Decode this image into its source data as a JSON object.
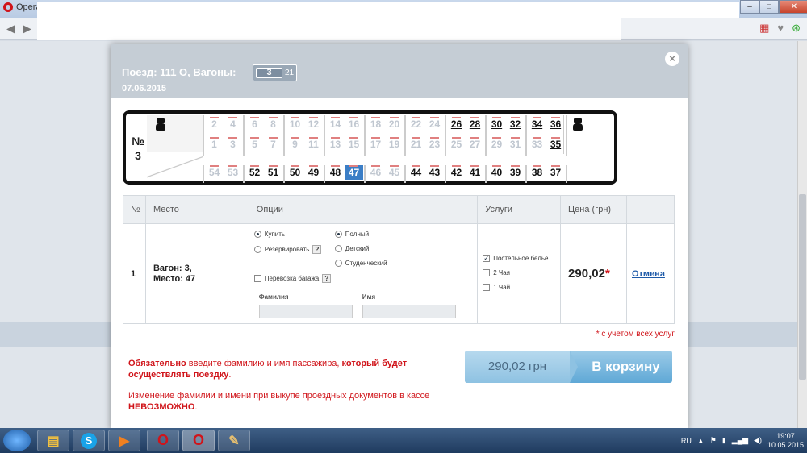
{
  "browser": {
    "app_name": "Opera",
    "window_buttons": [
      "–",
      "□",
      "✕"
    ]
  },
  "modal": {
    "title": "Поезд: 111 О, Вагоны:",
    "wagon_current": "3",
    "wagon_other": "21",
    "date": "07.06.2015",
    "close_label": "×"
  },
  "car": {
    "number_label": "№",
    "number": "3",
    "compartments_top": [
      {
        "upper_even": "2",
        "upper_even_status": "busy",
        "upper_even2": "4",
        "upper_even2_status": "busy",
        "lower_odd": "1",
        "lower_odd_status": "busy",
        "lower_odd2": "3",
        "lower_odd2_status": "busy"
      },
      {
        "upper_even": "6",
        "upper_even_status": "busy",
        "upper_even2": "8",
        "upper_even2_status": "busy",
        "lower_odd": "5",
        "lower_odd_status": "busy",
        "lower_odd2": "7",
        "lower_odd2_status": "busy"
      },
      {
        "upper_even": "10",
        "upper_even_status": "busy",
        "upper_even2": "12",
        "upper_even2_status": "busy",
        "lower_odd": "9",
        "lower_odd_status": "busy",
        "lower_odd2": "11",
        "lower_odd2_status": "busy"
      },
      {
        "upper_even": "14",
        "upper_even_status": "busy",
        "upper_even2": "16",
        "upper_even2_status": "busy",
        "lower_odd": "13",
        "lower_odd_status": "busy",
        "lower_odd2": "15",
        "lower_odd2_status": "busy"
      },
      {
        "upper_even": "18",
        "upper_even_status": "busy",
        "upper_even2": "20",
        "upper_even2_status": "busy",
        "lower_odd": "17",
        "lower_odd_status": "busy",
        "lower_odd2": "19",
        "lower_odd2_status": "busy"
      },
      {
        "upper_even": "22",
        "upper_even_status": "busy",
        "upper_even2": "24",
        "upper_even2_status": "busy",
        "lower_odd": "21",
        "lower_odd_status": "busy",
        "lower_odd2": "23",
        "lower_odd2_status": "busy"
      },
      {
        "upper_even": "26",
        "upper_even_status": "free",
        "upper_even2": "28",
        "upper_even2_status": "free",
        "lower_odd": "25",
        "lower_odd_status": "busy",
        "lower_odd2": "27",
        "lower_odd2_status": "busy"
      },
      {
        "upper_even": "30",
        "upper_even_status": "free",
        "upper_even2": "32",
        "upper_even2_status": "free",
        "lower_odd": "29",
        "lower_odd_status": "busy",
        "lower_odd2": "31",
        "lower_odd2_status": "busy"
      },
      {
        "upper_even": "34",
        "upper_even_status": "free",
        "upper_even2": "36",
        "upper_even2_status": "free",
        "lower_odd": "33",
        "lower_odd_status": "busy",
        "lower_odd2": "35",
        "lower_odd2_status": "free"
      }
    ],
    "side_seats": [
      {
        "a": "54",
        "a_status": "busy",
        "b": "53",
        "b_status": "busy"
      },
      {
        "a": "52",
        "a_status": "free",
        "b": "51",
        "b_status": "free"
      },
      {
        "a": "50",
        "a_status": "free",
        "b": "49",
        "b_status": "free"
      },
      {
        "a": "48",
        "a_status": "free",
        "b": "47",
        "b_status": "sel"
      },
      {
        "a": "46",
        "a_status": "busy",
        "b": "45",
        "b_status": "busy"
      },
      {
        "a": "44",
        "a_status": "free",
        "b": "43",
        "b_status": "free"
      },
      {
        "a": "42",
        "a_status": "free",
        "b": "41",
        "b_status": "free"
      },
      {
        "a": "40",
        "a_status": "free",
        "b": "39",
        "b_status": "free"
      },
      {
        "a": "38",
        "a_status": "free",
        "b": "37",
        "b_status": "free"
      }
    ]
  },
  "table": {
    "headers": [
      "№",
      "Место",
      "Опции",
      "Услуги",
      "Цена (грн)",
      ""
    ],
    "row": {
      "index": "1",
      "place_line1": "Вагон: 3,",
      "place_line2": "Место: 47",
      "option_buy": "Купить",
      "option_reserve": "Резервировать",
      "option_full": "Полный",
      "option_child": "Детский",
      "option_student": "Студенческий",
      "option_luggage": "Перевозка багажа",
      "help_mark": "?",
      "surname_label": "Фамилия",
      "name_label": "Имя",
      "service_linen": "Постельное белье",
      "service_tea2": "2 Чая",
      "service_tea1": "1 Чай",
      "price": "290,02",
      "price_star": "*",
      "cancel": "Отмена"
    }
  },
  "note_small": "* с учетом всех услуг",
  "warning1": {
    "bold1": "Обязательно",
    "text1": " введите фамилию и имя пассажира, ",
    "bold2": "который будет осуществлять поездку",
    "text2": "."
  },
  "warning2": {
    "text": "Изменение фамилии и имени при выкупе проездных документов в кассе ",
    "bold": "НЕВОЗМОЖНО",
    "end": "."
  },
  "cart": {
    "sum": "290,02 грн",
    "label": "В корзину"
  },
  "taskbar": {
    "lang": "RU",
    "time": "19:07",
    "date": "10.05.2015"
  }
}
